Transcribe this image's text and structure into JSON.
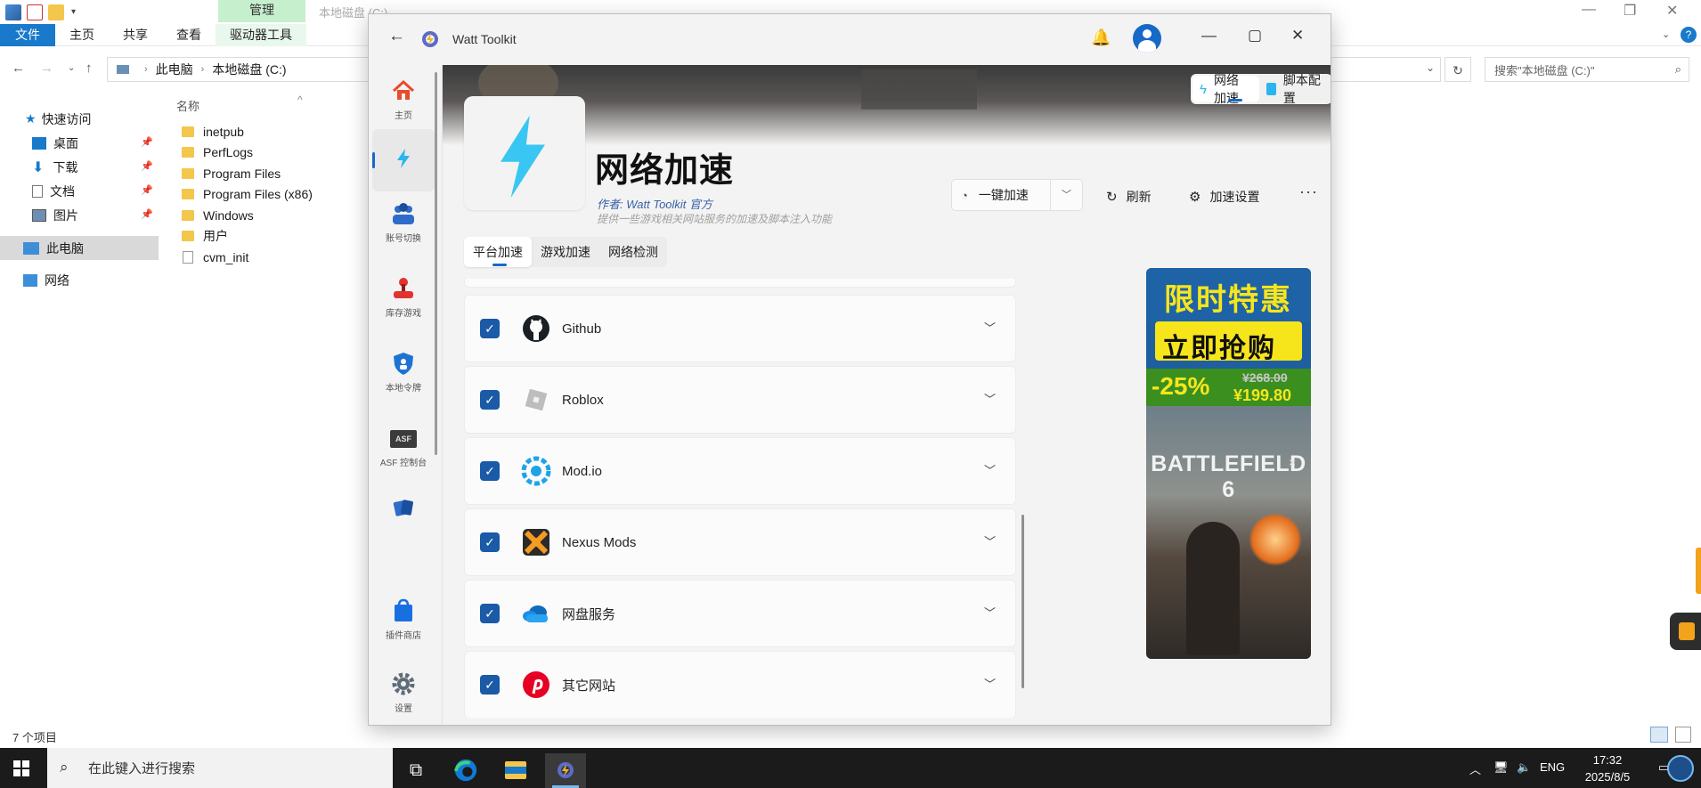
{
  "explorer": {
    "window_title": "本地磁盘 (C:)",
    "context_group_label": "管理",
    "ribbon_tabs": [
      "文件",
      "主页",
      "共享",
      "查看",
      "驱动器工具"
    ],
    "breadcrumb": [
      "此电脑",
      "本地磁盘 (C:)"
    ],
    "search_placeholder": "搜索\"本地磁盘 (C:)\"",
    "sidebar": [
      {
        "label": "快速访问",
        "icon": "star-icon",
        "pinned": false
      },
      {
        "label": "桌面",
        "icon": "desktop-icon",
        "pinned": true
      },
      {
        "label": "下载",
        "icon": "download-icon",
        "pinned": true
      },
      {
        "label": "文档",
        "icon": "document-icon",
        "pinned": true
      },
      {
        "label": "图片",
        "icon": "picture-icon",
        "pinned": true
      },
      {
        "label": "此电脑",
        "icon": "computer-icon",
        "pinned": false,
        "selected": true
      },
      {
        "label": "网络",
        "icon": "network-icon",
        "pinned": false
      }
    ],
    "column_name": "名称",
    "files": [
      {
        "name": "inetpub",
        "type": "folder"
      },
      {
        "name": "PerfLogs",
        "type": "folder"
      },
      {
        "name": "Program Files",
        "type": "folder"
      },
      {
        "name": "Program Files (x86)",
        "type": "folder"
      },
      {
        "name": "Windows",
        "type": "folder"
      },
      {
        "name": "用户",
        "type": "folder"
      },
      {
        "name": "cvm_init",
        "type": "file"
      }
    ],
    "status": "7 个项目"
  },
  "watt": {
    "app_name": "Watt Toolkit",
    "nav": [
      {
        "label": "主页",
        "icon": "home-icon"
      },
      {
        "label": "",
        "icon": "bolt-icon",
        "active": true
      },
      {
        "label": "账号切换",
        "icon": "accounts-icon"
      },
      {
        "label": "库存游戏",
        "icon": "joystick-icon"
      },
      {
        "label": "本地令牌",
        "icon": "shield-icon"
      },
      {
        "label": "ASF 控制台",
        "icon": "asf-icon",
        "icon_text": "ASF"
      },
      {
        "label": "",
        "icon": "cards-icon"
      },
      {
        "label": "插件商店",
        "icon": "store-icon"
      },
      {
        "label": "设置",
        "icon": "settings-icon"
      }
    ],
    "segment": [
      {
        "label": "网络加速",
        "active": true
      },
      {
        "label": "脚本配置",
        "active": false
      }
    ],
    "hero": {
      "title": "网络加速",
      "author": "作者:  Watt Toolkit 官方",
      "description": "提供一些游戏相关网站服务的加速及脚本注入功能"
    },
    "actions": {
      "one_click": "一键加速",
      "refresh": "刷新",
      "settings": "加速设置"
    },
    "tabs": [
      {
        "label": "平台加速",
        "active": true
      },
      {
        "label": "游戏加速",
        "active": false
      },
      {
        "label": "网络检测",
        "active": false
      }
    ],
    "sites": [
      {
        "name": "Github",
        "checked": true,
        "logo": "github-icon"
      },
      {
        "name": "Roblox",
        "checked": true,
        "logo": "roblox-icon"
      },
      {
        "name": "Mod.io",
        "checked": true,
        "logo": "modio-icon"
      },
      {
        "name": "Nexus Mods",
        "checked": true,
        "logo": "nexus-icon"
      },
      {
        "name": "网盘服务",
        "checked": true,
        "logo": "cloud-icon"
      },
      {
        "name": "其它网站",
        "checked": true,
        "logo": "pinterest-icon"
      }
    ],
    "ad": {
      "line1": "限时特惠",
      "line2": "立即抢购",
      "discount": "-25%",
      "old_price": "¥268.00",
      "new_price": "¥199.80",
      "game": "BATTLEFIELD 6"
    }
  },
  "taskbar": {
    "search_placeholder": "在此键入进行搜索",
    "ime": "ENG",
    "time": "17:32",
    "date": "2025/8/5"
  },
  "colors": {
    "accent": "#1669c7",
    "checkbox": "#1a5aa6",
    "explorer_file_tab": "#1979ca",
    "context_tab": "#c6efce",
    "taskbar": "#1b1b1b"
  }
}
